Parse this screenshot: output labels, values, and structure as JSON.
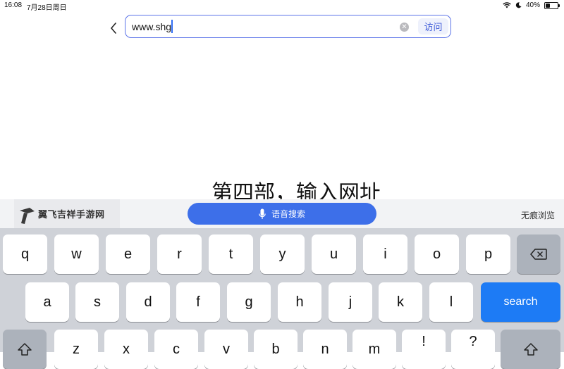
{
  "status_bar": {
    "time": "16:08",
    "date": "7月28日周日",
    "battery_percent": "40%",
    "battery_level": 0.4
  },
  "address_bar": {
    "value": "www.shg",
    "visit_label": "访问"
  },
  "caption": "第四部，输入网址",
  "watermark": {
    "text": "翼飞吉祥手游网"
  },
  "toolbar": {
    "voice_search_label": "语音搜索",
    "incognito_label": "无痕浏览"
  },
  "keyboard": {
    "row1": [
      "q",
      "w",
      "e",
      "r",
      "t",
      "y",
      "u",
      "i",
      "o",
      "p"
    ],
    "row2": [
      "a",
      "s",
      "d",
      "f",
      "g",
      "h",
      "j",
      "k",
      "l"
    ],
    "row3": [
      "z",
      "x",
      "c",
      "v",
      "b",
      "n",
      "m",
      "!",
      "?"
    ],
    "search_label": "search",
    "accent_color": "#1d7bf5"
  },
  "colors": {
    "accent": "#3d6fe9",
    "url_border": "#5b73e8"
  }
}
